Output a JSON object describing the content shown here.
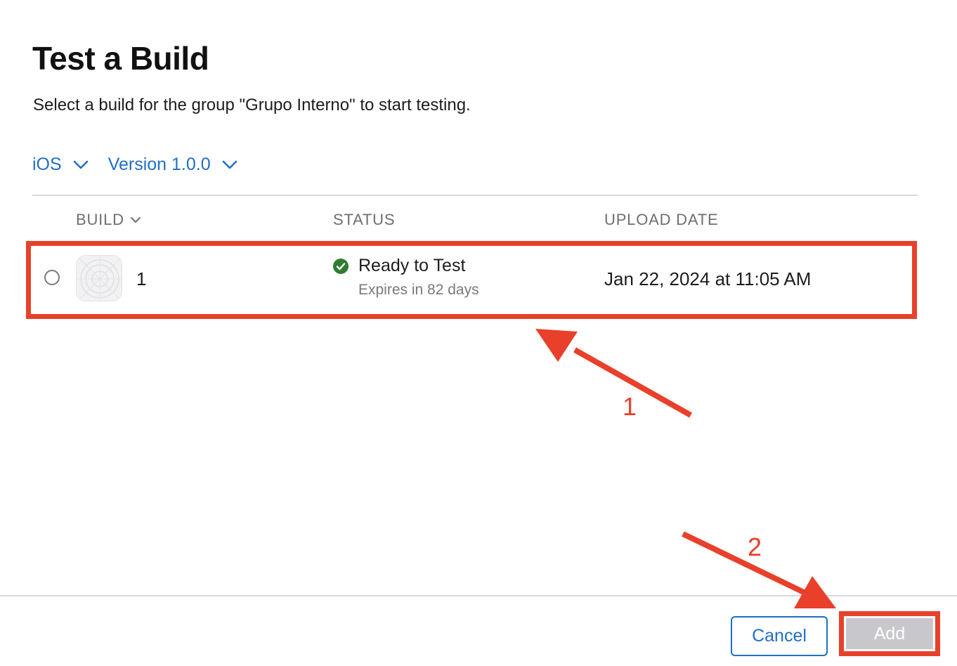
{
  "dialog": {
    "title": "Test a Build",
    "subtitle": "Select a build for the group \"Grupo Interno\" to start testing."
  },
  "filters": {
    "platform": "iOS",
    "version": "Version 1.0.0"
  },
  "table": {
    "columns": {
      "build": "BUILD",
      "status": "STATUS",
      "upload_date": "UPLOAD DATE"
    },
    "rows": [
      {
        "build": "1",
        "status": "Ready to Test",
        "expires": "Expires in 82 days",
        "upload_date": "Jan 22, 2024 at 11:05 AM",
        "selected": false
      }
    ]
  },
  "buttons": {
    "cancel": "Cancel",
    "add": "Add"
  },
  "annotations": {
    "step_1": "1",
    "step_2": "2"
  },
  "colors": {
    "accent": "#1f6fc5",
    "annotation": "#e8402a",
    "success": "#2e7d32",
    "disabled_button": "#c8c8cc"
  }
}
